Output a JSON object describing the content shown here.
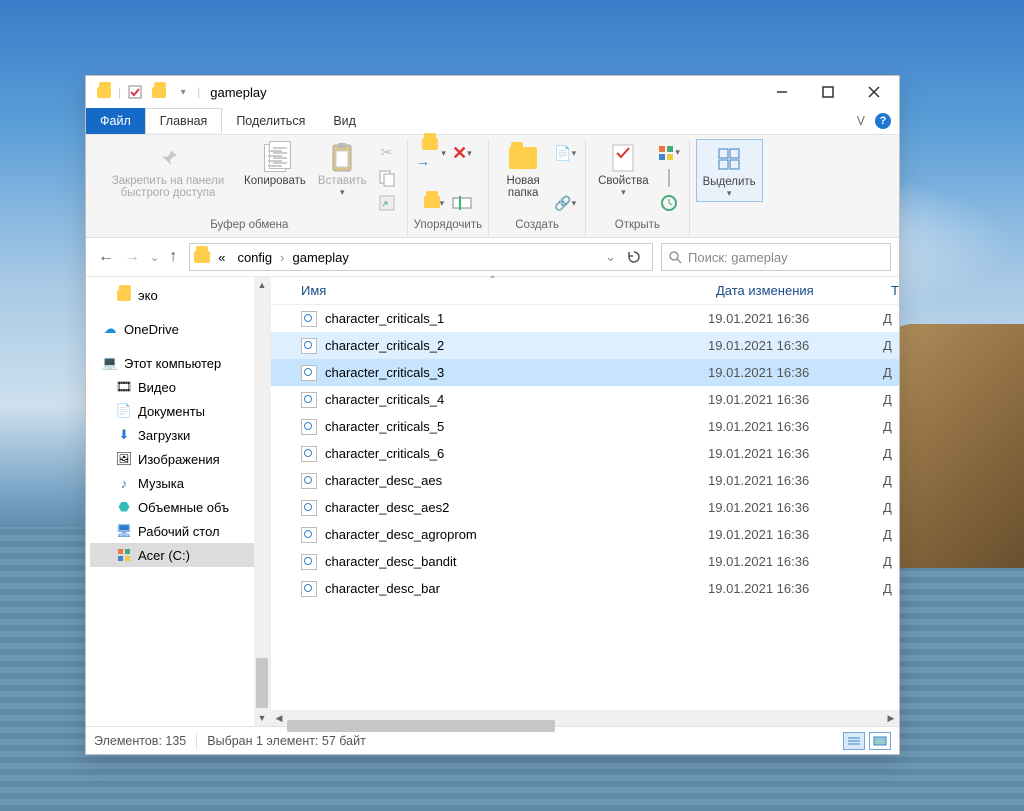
{
  "titlebar": {
    "title": "gameplay"
  },
  "tabs": {
    "file": "Файл",
    "home": "Главная",
    "share": "Поделиться",
    "view": "Вид"
  },
  "ribbon": {
    "pin": "Закрепить на панели\nбыстрого доступа",
    "copy": "Копировать",
    "paste": "Вставить",
    "group_clipboard": "Буфер обмена",
    "group_organize": "Упорядочить",
    "new_folder": "Новая\nпапка",
    "group_create": "Создать",
    "properties": "Свойства",
    "group_open": "Открыть",
    "select": "Выделить"
  },
  "address": {
    "prefix": "«",
    "crumb1": "config",
    "crumb2": "gameplay"
  },
  "search": {
    "placeholder": "Поиск: gameplay"
  },
  "columns": {
    "name": "Имя",
    "date": "Дата изменения",
    "type_initial": "Т"
  },
  "tree": {
    "eco": "эко",
    "onedrive": "OneDrive",
    "thispc": "Этот компьютер",
    "video": "Видео",
    "documents": "Документы",
    "downloads": "Загрузки",
    "pictures": "Изображения",
    "music": "Музыка",
    "objects3d": "Объемные объ",
    "desktop": "Рабочий стол",
    "drive_c": "Acer (C:)"
  },
  "files": [
    {
      "name": "character_criticals_1",
      "date": "19.01.2021 16:36",
      "t": "Д",
      "state": ""
    },
    {
      "name": "character_criticals_2",
      "date": "19.01.2021 16:36",
      "t": "Д",
      "state": "hl"
    },
    {
      "name": "character_criticals_3",
      "date": "19.01.2021 16:36",
      "t": "Д",
      "state": "sel"
    },
    {
      "name": "character_criticals_4",
      "date": "19.01.2021 16:36",
      "t": "Д",
      "state": ""
    },
    {
      "name": "character_criticals_5",
      "date": "19.01.2021 16:36",
      "t": "Д",
      "state": ""
    },
    {
      "name": "character_criticals_6",
      "date": "19.01.2021 16:36",
      "t": "Д",
      "state": ""
    },
    {
      "name": "character_desc_aes",
      "date": "19.01.2021 16:36",
      "t": "Д",
      "state": ""
    },
    {
      "name": "character_desc_aes2",
      "date": "19.01.2021 16:36",
      "t": "Д",
      "state": ""
    },
    {
      "name": "character_desc_agroprom",
      "date": "19.01.2021 16:36",
      "t": "Д",
      "state": ""
    },
    {
      "name": "character_desc_bandit",
      "date": "19.01.2021 16:36",
      "t": "Д",
      "state": ""
    },
    {
      "name": "character_desc_bar",
      "date": "19.01.2021 16:36",
      "t": "Д",
      "state": ""
    }
  ],
  "status": {
    "items": "Элементов: 135",
    "selection": "Выбран 1 элемент: 57 байт"
  }
}
